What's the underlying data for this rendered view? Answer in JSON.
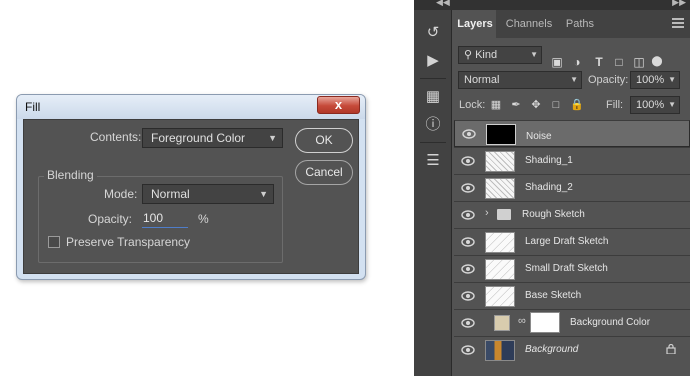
{
  "fill_dialog": {
    "title": "Fill",
    "close_label": "x",
    "contents_label": "Contents:",
    "contents_value": "Foreground Color",
    "blending_label": "Blending",
    "mode_label": "Mode:",
    "mode_value": "Normal",
    "opacity_label": "Opacity:",
    "opacity_value": "100",
    "opacity_unit": "%",
    "preserve_transparency_label": "Preserve Transparency",
    "ok_label": "OK",
    "cancel_label": "Cancel"
  },
  "layers_panel": {
    "tabs": [
      "Layers",
      "Channels",
      "Paths"
    ],
    "filter_label": "Kind",
    "blend_mode": "Normal",
    "opacity_label": "Opacity:",
    "opacity_value": "100%",
    "lock_label": "Lock:",
    "fill_label": "Fill:",
    "fill_value": "100%",
    "layers": [
      {
        "name": "Noise",
        "thumb": "black",
        "selected": true
      },
      {
        "name": "Shading_1",
        "thumb": "sketch"
      },
      {
        "name": "Shading_2",
        "thumb": "sketch"
      },
      {
        "name": "Rough Sketch",
        "thumb": "folder"
      },
      {
        "name": "Large Draft Sketch",
        "thumb": "light"
      },
      {
        "name": "Small Draft Sketch",
        "thumb": "light"
      },
      {
        "name": "Base Sketch",
        "thumb": "light"
      },
      {
        "name": "Background Color",
        "thumb": "fill"
      },
      {
        "name": "Background",
        "thumb": "photo",
        "locked": true
      }
    ]
  },
  "colors": {
    "dialog_frame": "#d3e1f1",
    "dialog_body": "#535353",
    "panel_bg": "#535353",
    "selected_row": "#6b6b6b",
    "background_color_swatch": "#d8ccae"
  }
}
